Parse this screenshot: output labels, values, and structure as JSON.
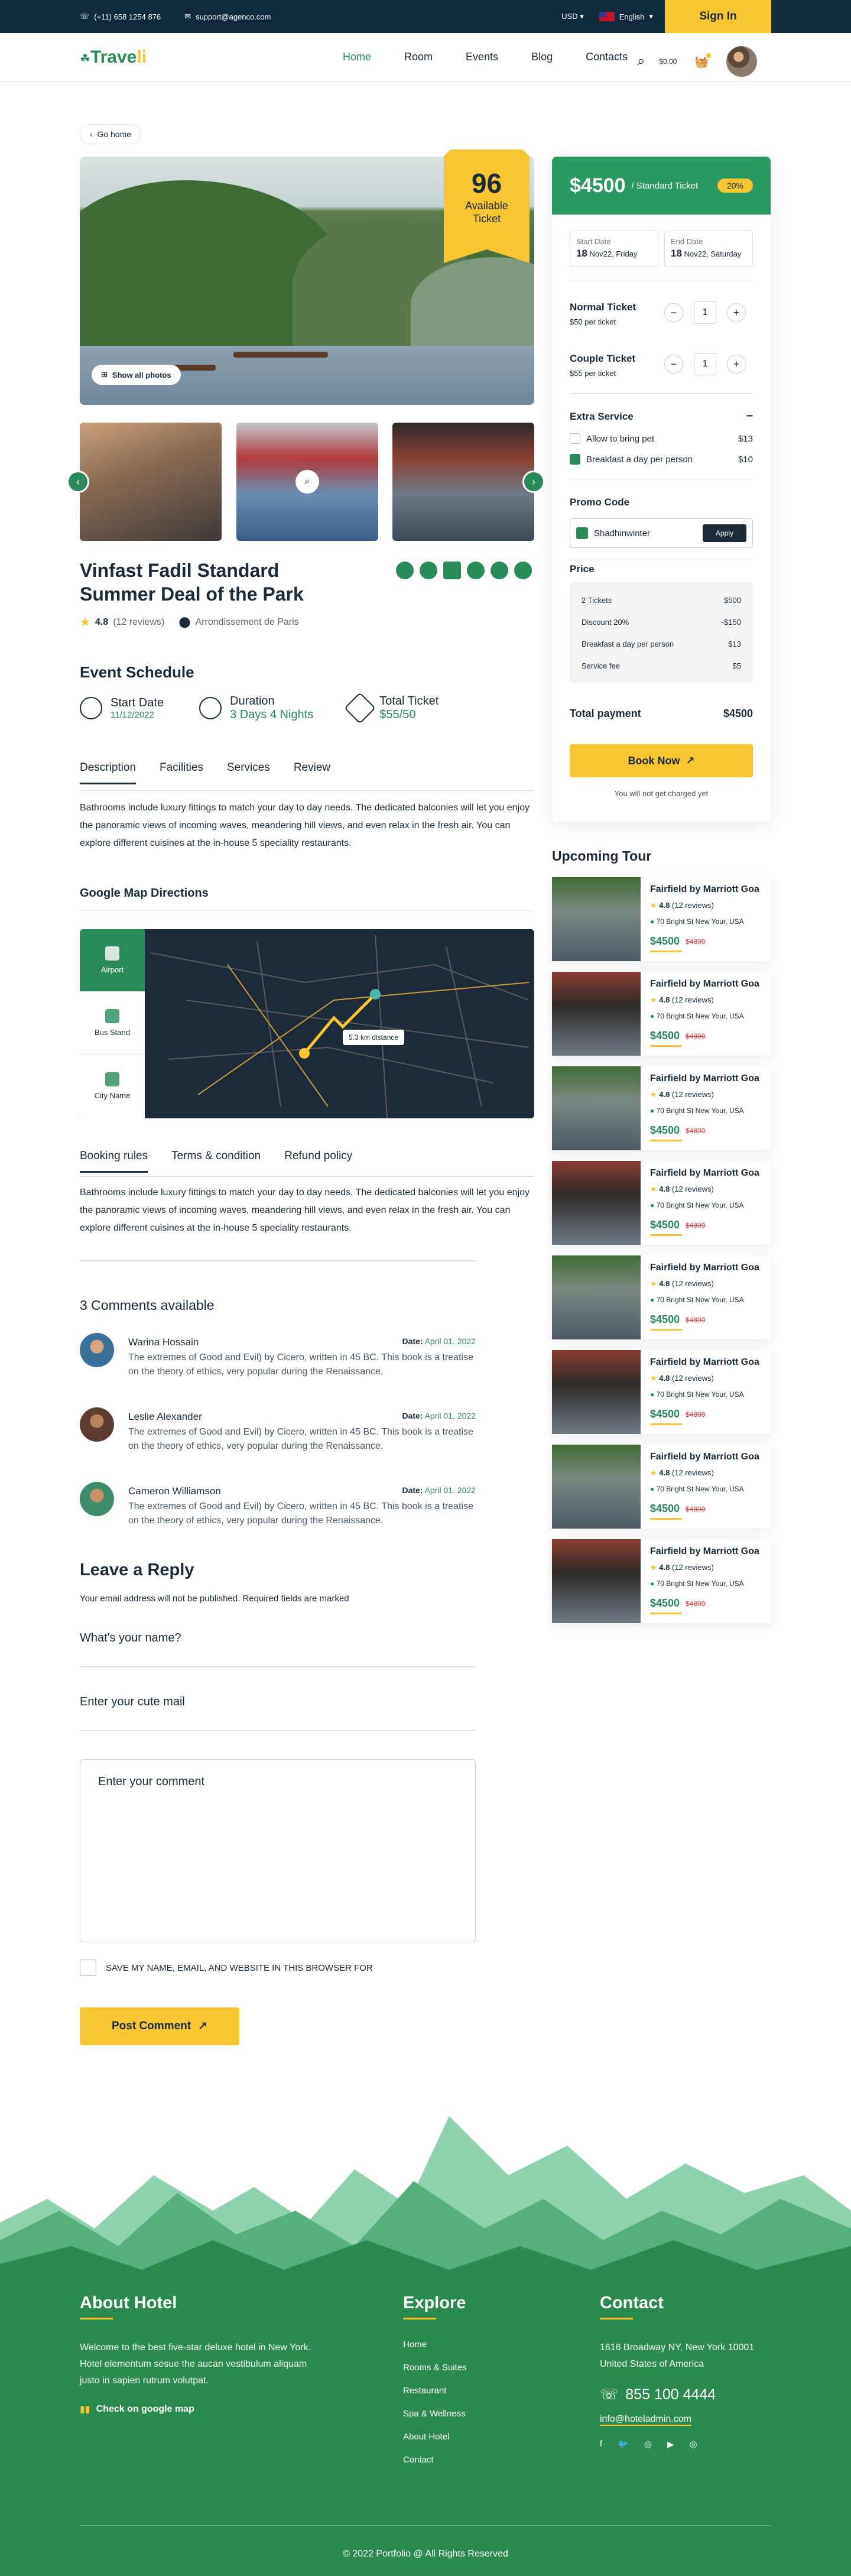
{
  "topbar": {
    "phone": "(+11) 658 1254 876",
    "email": "support@agenco.com",
    "currency": "USD",
    "language": "English",
    "sign_in": "Sign In"
  },
  "nav": {
    "logo": "Trave",
    "logo_tail": "li",
    "items": [
      "Home",
      "Room",
      "Events",
      "Blog",
      "Contacts"
    ],
    "cart_amount": "$0.00"
  },
  "breadcrumb": "Go home",
  "hero": {
    "badge_number": "96",
    "badge_text_1": "Available",
    "badge_text_2": "Ticket",
    "show_all": "Show all photos"
  },
  "event": {
    "title": "Vinfast Fadil Standard Summer Deal of the Park",
    "rating": "4.8",
    "reviews": "(12 reviews)",
    "location": "Arrondissement de Paris"
  },
  "schedule": {
    "title": "Event Schedule",
    "start_label": "Start Date",
    "start_value": "11/12/2022",
    "duration_label": "Duration",
    "duration_value": "3 Days 4 Nights",
    "ticket_label": "Total Ticket",
    "ticket_value": "$55/50"
  },
  "tabs": [
    "Description",
    "Facilities",
    "Services",
    "Review"
  ],
  "description": "Bathrooms include luxury fittings to match your day to day needs. The dedicated balconies will let you enjoy the panoramic views of incoming waves, meandering hill views, and even relax in the fresh air. You can explore different cuisines at the in-house 5 speciality restaurants.",
  "map": {
    "title": "Google Map Directions",
    "options": [
      "Airport",
      "Bus Stand",
      "City Name"
    ],
    "distance": "5.3 km distance"
  },
  "rules_tabs": [
    "Booking rules",
    "Terms & condition",
    "Refund policy"
  ],
  "rules_text": "Bathrooms include luxury fittings to match your day to day needs. The dedicated balconies will let you enjoy the panoramic views of incoming waves, meandering hill views, and even relax in the fresh air. You can explore different cuisines at the in-house 5 speciality restaurants.",
  "comments": {
    "title": "3 Comments available",
    "date_label": "Date:",
    "items": [
      {
        "name": "Warina Hossain",
        "date": "April 01, 2022",
        "text": "The extremes of Good and Evil) by Cicero, written in 45 BC. This book is a treatise on the theory of ethics, very popular during the Renaissance."
      },
      {
        "name": "Leslie Alexander",
        "date": "April 01, 2022",
        "text": "The extremes of Good and Evil) by Cicero, written in 45 BC. This book is a treatise on the theory of ethics, very popular during the Renaissance."
      },
      {
        "name": "Cameron Williamson",
        "date": "April 01, 2022",
        "text": "The extremes of Good and Evil) by Cicero, written in 45 BC. This book is a treatise on the theory of ethics, very popular during the Renaissance."
      }
    ]
  },
  "reply": {
    "title": "Leave a Reply",
    "subtitle": "Your email address will not be published. Required fields are marked",
    "name_placeholder": "What's your name?",
    "mail_placeholder": "Enter your cute mail",
    "comment_placeholder": "Enter your comment",
    "save_label": "SAVE MY NAME, EMAIL, AND WEBSITE IN THIS BROWSER FOR",
    "post_label": "Post Comment"
  },
  "booking": {
    "price": "$4500",
    "price_label": "/ Standard Ticket",
    "discount": "20%",
    "start_label": "Start Date",
    "start_day": "18",
    "start_rest": "Nov22, Friday",
    "end_label": "End Date",
    "end_day": "18",
    "end_rest": "Nov22, Saturday",
    "normal_label": "Normal Ticket",
    "normal_price": "$50 per ticket",
    "normal_qty": "1",
    "couple_label": "Couple Ticket",
    "couple_price": "$55 per ticket",
    "couple_qty": "1",
    "extra_title": "Extra Service",
    "extra_1": "Allow to bring pet",
    "extra_1_price": "$13",
    "extra_2": "Breakfast a day per person",
    "extra_2_price": "$10",
    "promo_title": "Promo Code",
    "promo_value": "Shadhinwinter",
    "promo_apply": "Apply",
    "price_title": "Price",
    "lines": [
      {
        "label": "2 Tickets",
        "value": "$500"
      },
      {
        "label": "Discount 20%",
        "value": "-$150"
      },
      {
        "label": "Breakfast a day per person",
        "value": "$13"
      },
      {
        "label": "Service fee",
        "value": "$5"
      }
    ],
    "total_label": "Total payment",
    "total_value": "$4500",
    "book_now": "Book Now",
    "note": "You will not get charged yet"
  },
  "upcoming": {
    "title": "Upcoming Tour",
    "items": [
      {
        "name": "Fairfield by Marriott Goa",
        "rating": "4.8",
        "reviews": "(12 reviews)",
        "address": "70 Bright St New Your, USA",
        "price": "$4500",
        "old": "$4800"
      },
      {
        "name": "Fairfield by Marriott Goa",
        "rating": "4.8",
        "reviews": "(12 reviews)",
        "address": "70 Bright St New Your, USA",
        "price": "$4500",
        "old": "$4800"
      },
      {
        "name": "Fairfield by Marriott Goa",
        "rating": "4.8",
        "reviews": "(12 reviews)",
        "address": "70 Bright St New Your, USA",
        "price": "$4500",
        "old": "$4800"
      },
      {
        "name": "Fairfield by Marriott Goa",
        "rating": "4.8",
        "reviews": "(12 reviews)",
        "address": "70 Bright St New Your, USA",
        "price": "$4500",
        "old": "$4800"
      },
      {
        "name": "Fairfield by Marriott Goa",
        "rating": "4.8",
        "reviews": "(12 reviews)",
        "address": "70 Bright St New Your, USA",
        "price": "$4500",
        "old": "$4800"
      },
      {
        "name": "Fairfield by Marriott Goa",
        "rating": "4.8",
        "reviews": "(12 reviews)",
        "address": "70 Bright St New Your, USA",
        "price": "$4500",
        "old": "$4800"
      },
      {
        "name": "Fairfield by Marriott Goa",
        "rating": "4.8",
        "reviews": "(12 reviews)",
        "address": "70 Bright St New Your, USA",
        "price": "$4500",
        "old": "$4800"
      },
      {
        "name": "Fairfield by Marriott Goa",
        "rating": "4.8",
        "reviews": "(12 reviews)",
        "address": "70 Bright St New Your, USA",
        "price": "$4500",
        "old": "$4800"
      }
    ]
  },
  "footer": {
    "about_title": "About Hotel",
    "about_text": "Welcome to the best five-star deluxe hotel in New York. Hotel elementum sesue the aucan vestibulum aliquam justo in sapien rutrum volutpat.",
    "map_link": "Check on google map",
    "explore_title": "Explore",
    "explore": [
      "Home",
      "Rooms & Suites",
      "Restaurant",
      "Spa & Wellness",
      "About Hotel",
      "Contact"
    ],
    "contact_title": "Contact",
    "address": "1616 Broadway NY, New York 10001 United States of America",
    "phone": "855 100 4444",
    "email": "info@hoteladmin.com",
    "copyright": "© 2022 Portfolio @ All Rights Reserved"
  },
  "colors": {
    "brand": "#2b8a5a",
    "accent": "#f6c531",
    "dark": "#0e2a3c"
  }
}
